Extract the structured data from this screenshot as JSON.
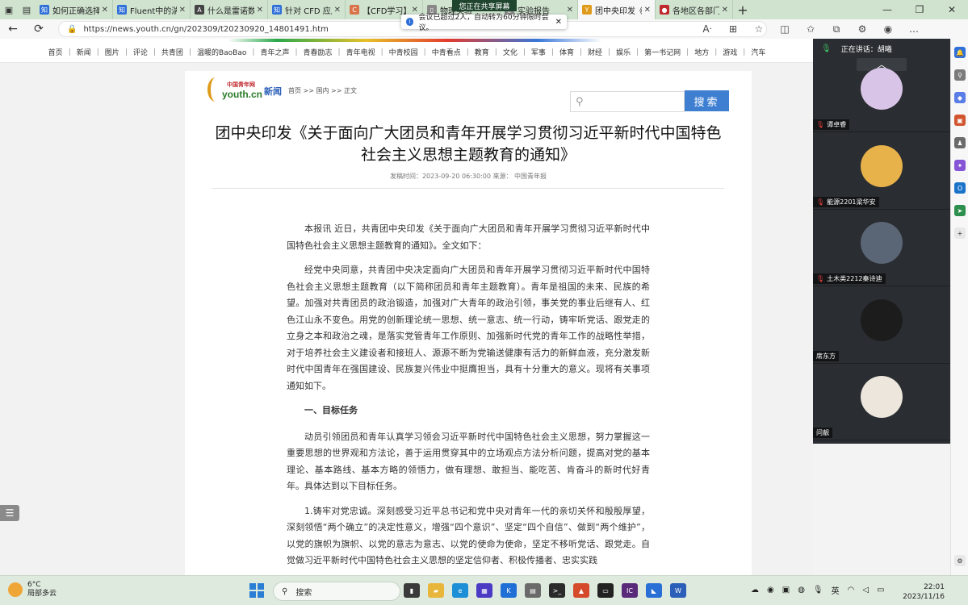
{
  "browser": {
    "tabs": [
      {
        "label": "如何正确选择",
        "favicon_color": "#2f6fd8",
        "favicon": "知",
        "active": false
      },
      {
        "label": "Fluent中的湍",
        "favicon_color": "#2f6fd8",
        "favicon": "知",
        "active": false
      },
      {
        "label": "什么是雷诺数",
        "favicon_color": "#444444",
        "favicon": "A",
        "active": false
      },
      {
        "label": "针对 CFD 应用",
        "favicon_color": "#2f6fd8",
        "favicon": "知",
        "active": false
      },
      {
        "label": "【CFD学习】",
        "favicon_color": "#d9734a",
        "favicon": "C",
        "active": false
      },
      {
        "label": "物理实验",
        "favicon_color": "#888888",
        "favicon": "▯",
        "active": false
      },
      {
        "label": "实验报告",
        "favicon_color": "#888888",
        "favicon": "▯",
        "active": false
      },
      {
        "label": "团中央印发《",
        "favicon_color": "#e09a1a",
        "favicon": "Y",
        "active": true
      },
      {
        "label": "各地区各部门",
        "favicon_color": "#c0282d",
        "favicon": "●",
        "active": false
      }
    ],
    "url": "https://news.youth.cn/gn/202309/t20230920_14801491.htm",
    "share_indicator": "您正在共享屏幕",
    "notice": "会议已超过2人，自动转为60分钟限时会议。"
  },
  "site": {
    "nav": [
      "首页",
      "新闻",
      "图片",
      "评论",
      "共青团",
      "温暖的BaoBao",
      "青年之声",
      "青春励志",
      "青年电视",
      "中青校园",
      "中青看点",
      "教育",
      "文化",
      "军事",
      "体育",
      "财经",
      "娱乐",
      "第一书记网",
      "地方",
      "游戏",
      "汽车"
    ],
    "logo_cn": "中国青年网",
    "logo_en": "youth.cn",
    "section": "新闻",
    "breadcrumb": "首页 >> 国内 >> 正文",
    "search_button": "搜索"
  },
  "article": {
    "title": "团中央印发《关于面向广大团员和青年开展学习贯彻习近平新时代中国特色社会主义思想主题教育的通知》",
    "meta": "发稿时间：2023-09-20 06:30:00 来源： 中国青年报",
    "p1": "本报讯 近日，共青团中央印发《关于面向广大团员和青年开展学习贯彻习近平新时代中国特色社会主义思想主题教育的通知》。全文如下：",
    "p2": "经党中央同意，共青团中央决定面向广大团员和青年开展学习贯彻习近平新时代中国特色社会主义思想主题教育（以下简称团员和青年主题教育）。青年是祖国的未来、民族的希望。加强对共青团员的政治锻造，加强对广大青年的政治引领，事关党的事业后继有人、红色江山永不变色。用党的创新理论统一思想、统一意志、统一行动，铸牢听党话、跟党走的立身之本和政治之魂，是落实党管青年工作原则、加强新时代党的青年工作的战略性举措，对于培养社会主义建设者和接班人、源源不断为党输送健康有活力的新鲜血液，充分激发新时代中国青年在强国建设、民族复兴伟业中挺膺担当，具有十分重大的意义。现将有关事项通知如下。",
    "h1": "一、目标任务",
    "p3": "动员引领团员和青年认真学习领会习近平新时代中国特色社会主义思想，努力掌握这一重要思想的世界观和方法论，善于运用贯穿其中的立场观点方法分析问题，提高对党的基本理论、基本路线、基本方略的领悟力，做有理想、敢担当、能吃苦、肯奋斗的新时代好青年。具体达到以下目标任务。",
    "p4": "1.铸牢对党忠诚。深刻感受习近平总书记和党中央对青年一代的亲切关怀和殷殷厚望，深刻领悟“两个确立”的决定性意义，增强“四个意识”、坚定“四个自信”、做到“两个维护”，以党的旗帜为旗帜、以党的意志为意志、以党的使命为使命，坚定不移听党话、跟党走。自觉做习近平新时代中国特色社会主义思想的坚定信仰者、积极传播者、忠实实践"
  },
  "meeting": {
    "speaking_label": "正在讲话：",
    "speaker": "胡曦",
    "participants": [
      {
        "name": "谭卓睿",
        "avatar_color": "#d7c4e6",
        "muted": true
      },
      {
        "name": "能源2201梁华安",
        "avatar_color": "#e8b24a",
        "muted": true
      },
      {
        "name": "土木类2212秦诗迪",
        "avatar_color": "#5a6676",
        "muted": true
      },
      {
        "name": "席东方",
        "avatar_color": "#1c1c1c",
        "muted": false
      },
      {
        "name": "问靓",
        "avatar_color": "#ece6dd",
        "muted": false
      }
    ]
  },
  "taskbar": {
    "temp": "6°C",
    "weather": "局部多云",
    "search_placeholder": "搜索",
    "tray_lang": "英",
    "time": "22:01",
    "date": "2023/11/16"
  }
}
